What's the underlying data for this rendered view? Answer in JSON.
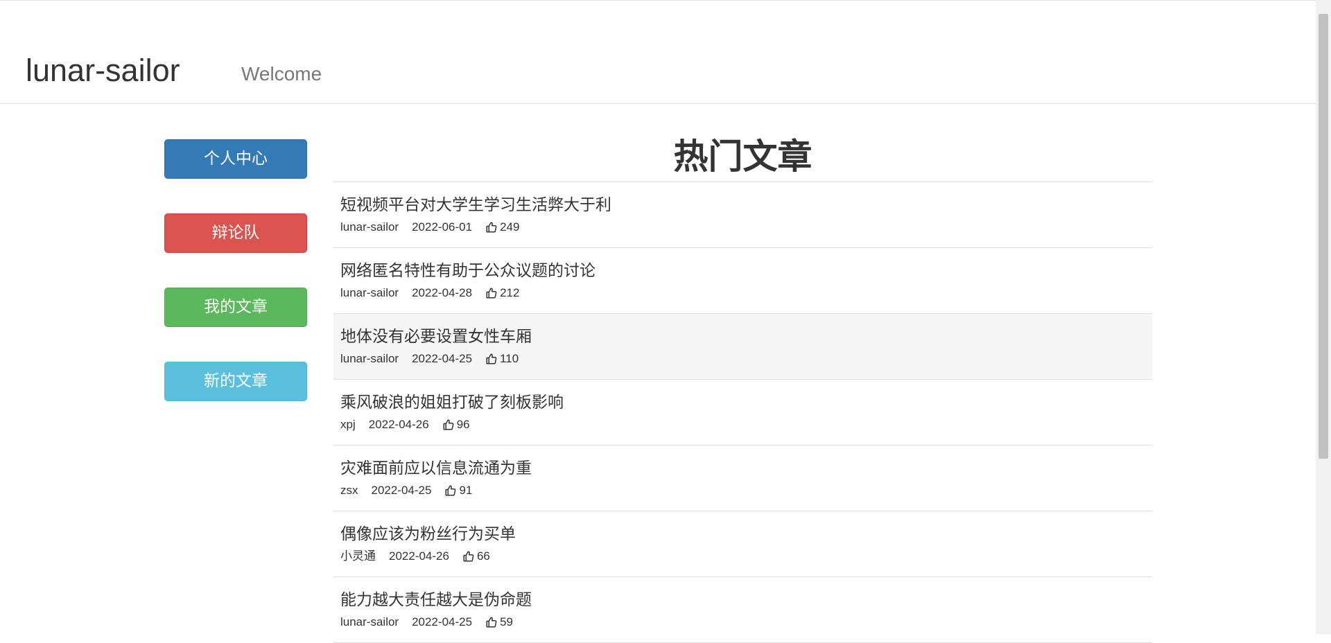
{
  "header": {
    "brand": "lunar-sailor",
    "welcome": "Welcome"
  },
  "sidebar": {
    "buttons": [
      {
        "label": "个人中心"
      },
      {
        "label": "辩论队"
      },
      {
        "label": "我的文章"
      },
      {
        "label": "新的文章"
      }
    ]
  },
  "main": {
    "title": "热门文章",
    "articles": [
      {
        "title": "短视频平台对大学生学习生活弊大于利",
        "author": "lunar-sailor",
        "date": "2022-06-01",
        "likes": "249"
      },
      {
        "title": "网络匿名特性有助于公众议题的讨论",
        "author": "lunar-sailor",
        "date": "2022-04-28",
        "likes": "212"
      },
      {
        "title": "地体没有必要设置女性车厢",
        "author": "lunar-sailor",
        "date": "2022-04-25",
        "likes": "110"
      },
      {
        "title": "乘风破浪的姐姐打破了刻板影响",
        "author": "xpj",
        "date": "2022-04-26",
        "likes": "96"
      },
      {
        "title": "灾难面前应以信息流通为重",
        "author": "zsx",
        "date": "2022-04-25",
        "likes": "91"
      },
      {
        "title": "偶像应该为粉丝行为买单",
        "author": "小灵通",
        "date": "2022-04-26",
        "likes": "66"
      },
      {
        "title": "能力越大责任越大是伪命题",
        "author": "lunar-sailor",
        "date": "2022-04-25",
        "likes": "59"
      }
    ]
  },
  "icons": {
    "like": "thumbs-up-icon"
  },
  "colors": {
    "primary": "#337ab7",
    "danger": "#d9534f",
    "success": "#5cb85c",
    "info": "#5bc0de",
    "hover_row": "#f5f5f5"
  }
}
